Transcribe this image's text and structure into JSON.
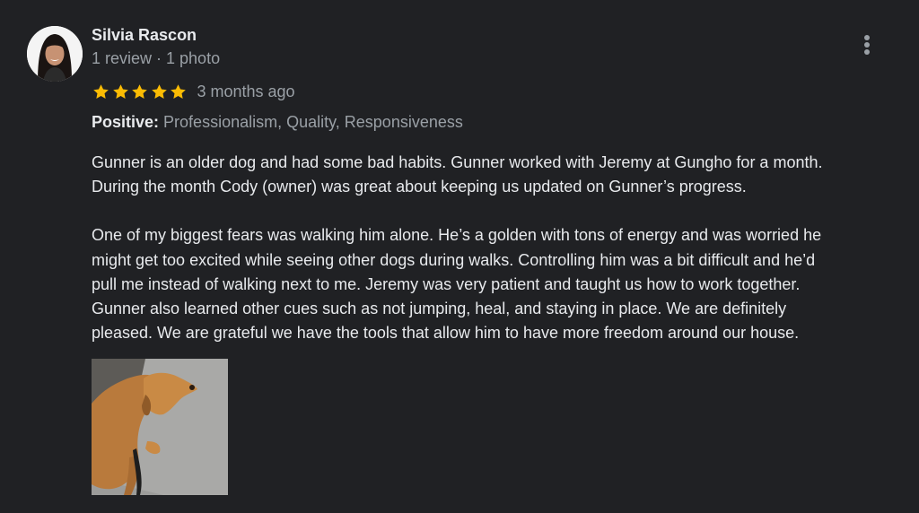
{
  "reviewer": {
    "name": "Silvia Rascon",
    "meta": "1 review · 1 photo"
  },
  "rating": {
    "stars": 5,
    "max_stars": 5,
    "time_ago": "3 months ago",
    "star_color": "#fbbc04"
  },
  "attributes": {
    "label": "Positive:",
    "value": "Professionalism, Quality, Responsiveness"
  },
  "review": {
    "paragraph1": [
      "Gunner is an older dog and had some bad habits. Gunner worked with Jeremy at Gungho for a month.",
      "During the month Cody (owner) was great about keeping us updated on Gunner’s progress."
    ],
    "paragraph2": [
      "One of my biggest fears was walking him alone. He’s a golden with tons of energy and was worried he",
      "might get too excited while seeing other dogs during walks. Controlling him was a bit difficult and he’d",
      "pull me instead of walking next to me. Jeremy was very patient and taught us how to work together.",
      "Gunner also learned other cues such as not jumping, heal, and staying in place. We are definitely",
      "pleased. We are grateful we have the tools that allow him to have more freedom around our house."
    ]
  },
  "icons": {
    "more": "more-vert-icon",
    "star": "star-icon"
  },
  "colors": {
    "background": "#202124",
    "primary_text": "#e8eaed",
    "secondary_text": "#9aa0a6"
  }
}
